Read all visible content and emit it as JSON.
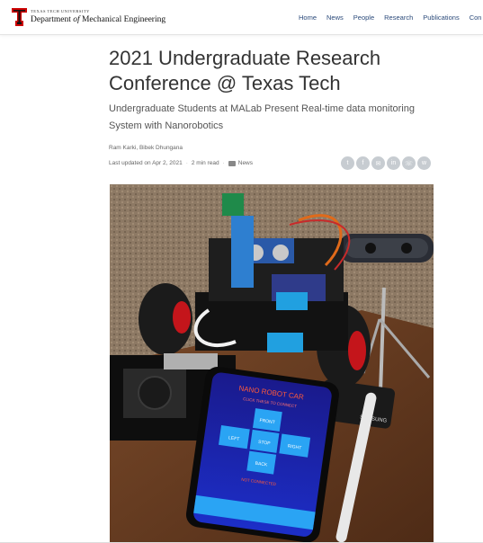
{
  "header": {
    "university": "TEXAS TECH UNIVERSITY",
    "department_before": "Department ",
    "department_of": "of",
    "department_after": " Mechanical Engineering",
    "brand_color": "#cc0000"
  },
  "nav": {
    "items": [
      "Home",
      "News",
      "People",
      "Research",
      "Publications",
      "Con"
    ]
  },
  "article": {
    "title": "2021 Undergraduate Research Conference @ Texas Tech",
    "subtitle": "Undergraduate Students at MALab Present Real-time data monitoring System with Nanorobotics",
    "authors": "Ram Karki, Bibek Dhungana",
    "updated": "Last updated on Apr 2, 2021",
    "read_time": "2 min read",
    "category": "News"
  },
  "share_icons": [
    "twitter-icon",
    "facebook-icon",
    "email-icon",
    "linkedin-icon",
    "whatsapp-icon",
    "weibo-icon"
  ],
  "photo": {
    "phone_title": "NANO ROBOT CAR",
    "phone_subtitle": "CLICK THESE TO CONNECT",
    "buttons": {
      "front": "FRONT",
      "left": "LEFT",
      "stop": "STOP",
      "right": "RIGHT",
      "back": "BACK"
    },
    "status": "NOT CONNECTED",
    "remote_brand": "SAMSUNG"
  }
}
